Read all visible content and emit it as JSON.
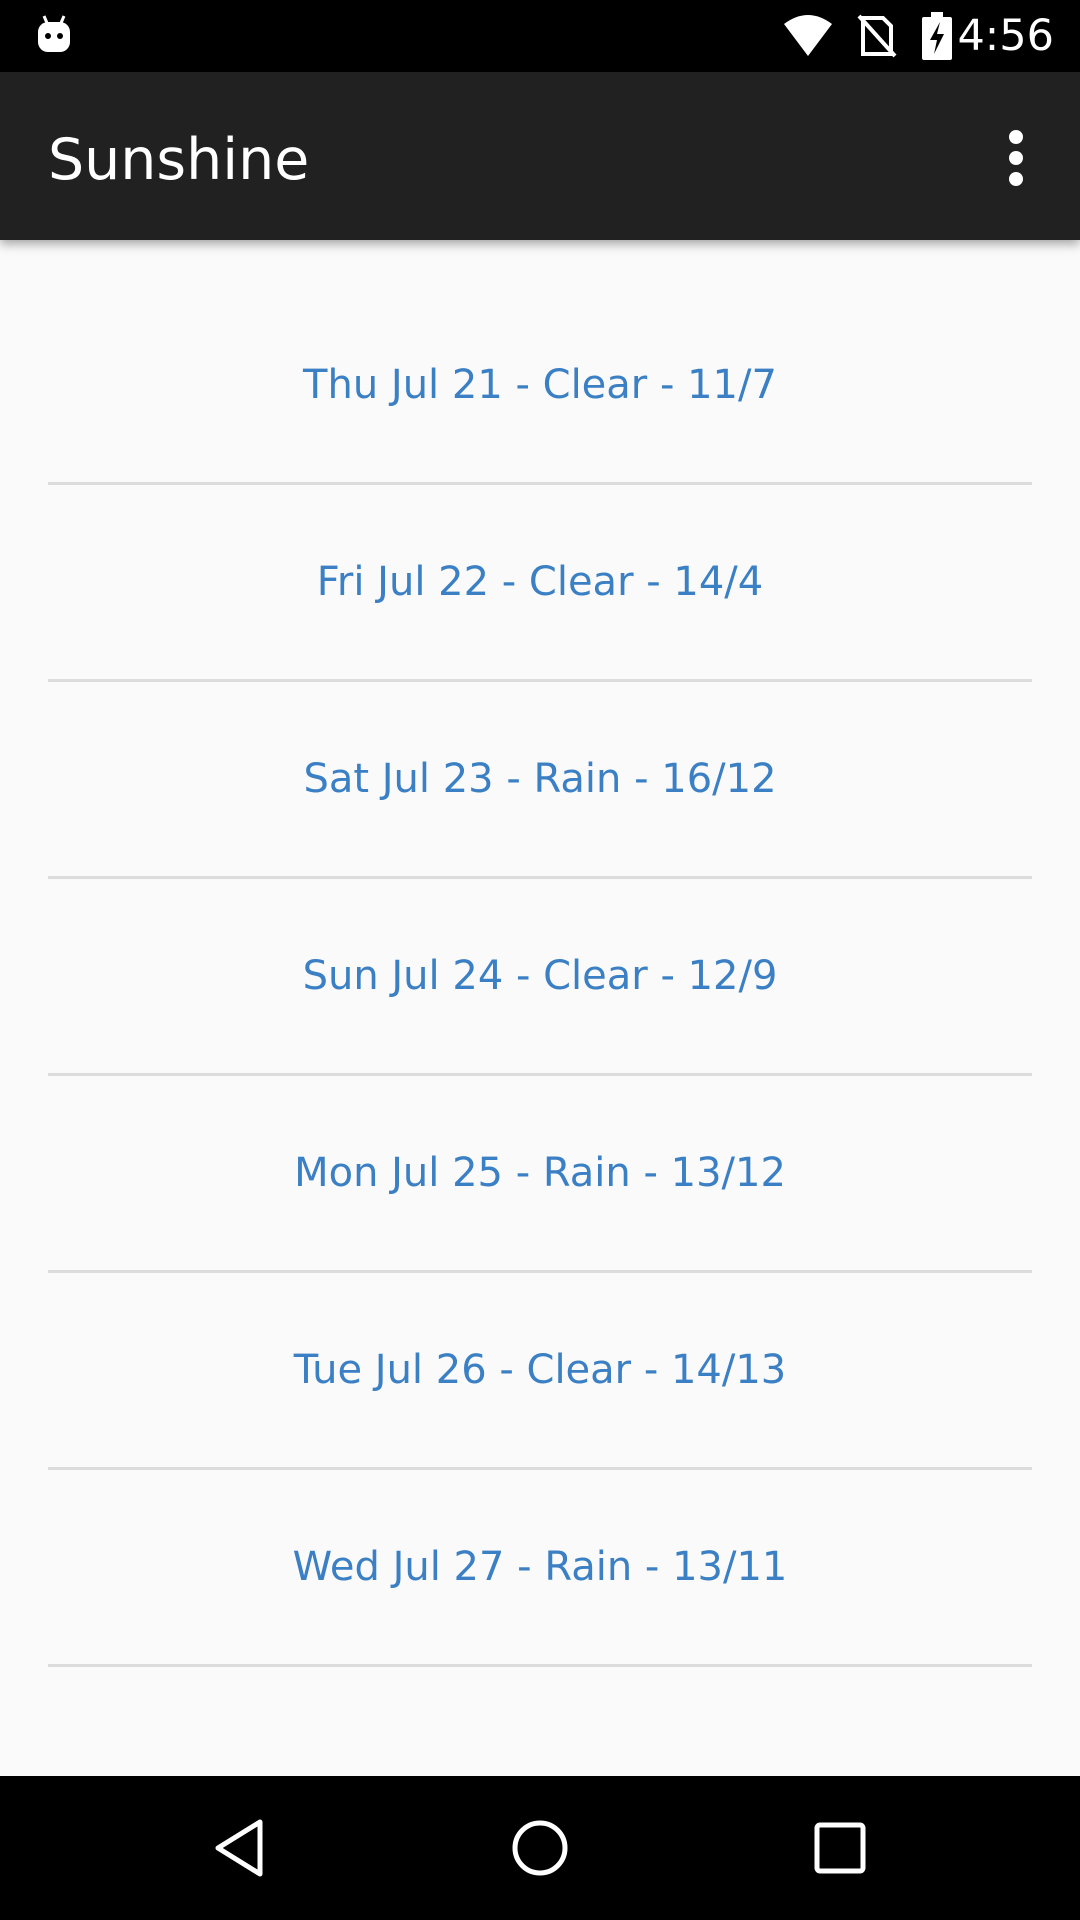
{
  "status_bar": {
    "time": "4:56",
    "icons": [
      "android-icon",
      "wifi-icon",
      "no-signal-icon",
      "battery-charging-icon"
    ]
  },
  "app_bar": {
    "title": "Sunshine",
    "overflow_icon": "more-vert-icon"
  },
  "forecast": {
    "items": [
      {
        "label": "Thu Jul 21 - Clear - 11/7"
      },
      {
        "label": "Fri Jul 22 - Clear - 14/4"
      },
      {
        "label": "Sat Jul 23 - Rain - 16/12"
      },
      {
        "label": "Sun Jul 24 - Clear - 12/9"
      },
      {
        "label": "Mon Jul 25 - Rain - 13/12"
      },
      {
        "label": "Tue Jul 26 - Clear - 14/13"
      },
      {
        "label": "Wed Jul 27 - Rain - 13/11"
      }
    ]
  },
  "nav_bar": {
    "icons": [
      "back-icon",
      "home-icon",
      "recents-icon"
    ]
  },
  "colors": {
    "status_bar": "#000000",
    "app_bar": "#212121",
    "background": "#fafafa",
    "item_text": "#3b7fc4",
    "divider": "#dcdcdc"
  }
}
